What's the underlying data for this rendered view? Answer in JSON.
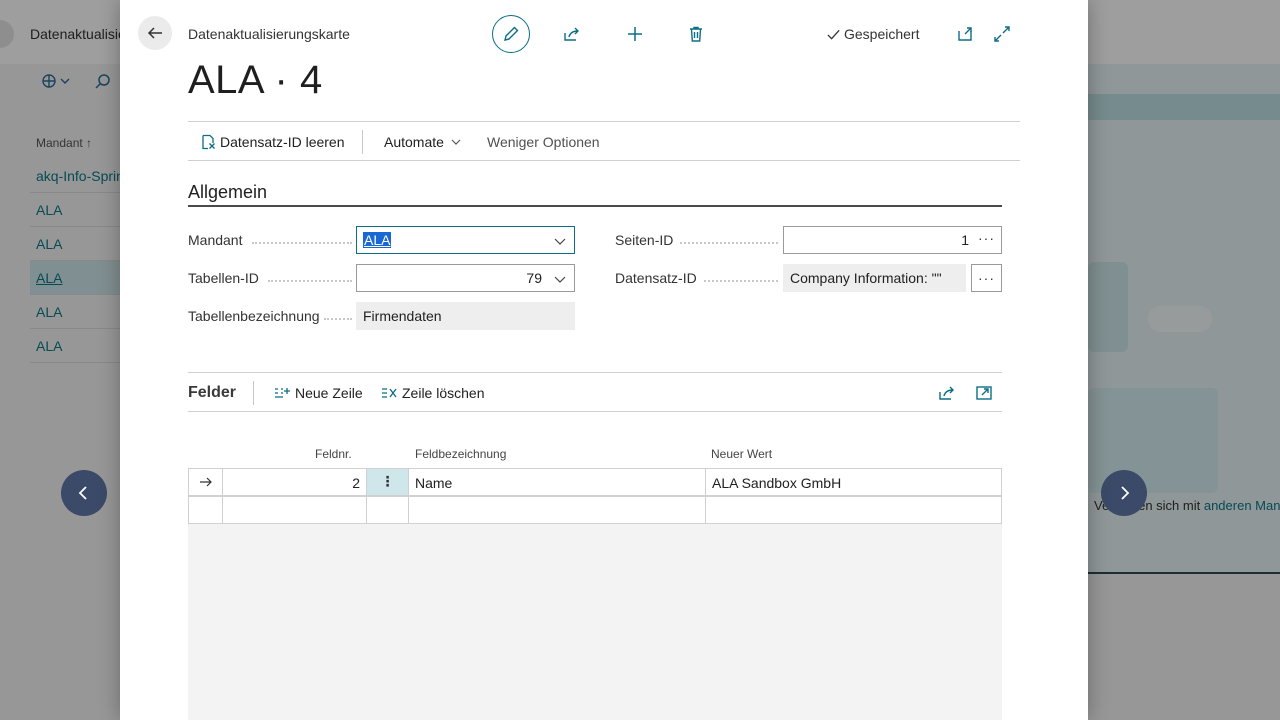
{
  "background": {
    "title": "Datenaktualisierungsliste",
    "column_header": "Mandant ↑",
    "rows": [
      "akq-Info-Sprint",
      "ALA",
      "ALA",
      "ALA",
      "ALA",
      "ALA"
    ],
    "selected_row_index": 3,
    "right_panel_text": "Verbinden sich mit ",
    "right_panel_link": "anderen Mandanten"
  },
  "dialog": {
    "caption": "Datenaktualisierungskarte",
    "saved_label": "Gespeichert",
    "record_title": "ALA · 4",
    "actions": {
      "clear_record_id": "Datensatz-ID leeren",
      "automate": "Automate",
      "fewer_options": "Weniger Optionen"
    },
    "general": {
      "title": "Allgemein",
      "mandant_label": "Mandant",
      "mandant_value": "ALA",
      "table_id_label": "Tabellen-ID",
      "table_id_value": "79",
      "table_name_label": "Tabellenbezeichnung",
      "table_name_value": "Firmendaten",
      "page_id_label": "Seiten-ID",
      "page_id_value": "1",
      "record_id_label": "Datensatz-ID",
      "record_id_value": "Company Information: \"\""
    },
    "fields_part": {
      "title": "Felder",
      "new_line": "Neue Zeile",
      "delete_line": "Zeile löschen",
      "columns": {
        "field_no": "Feldnr.",
        "field_name": "Feldbezeichnung",
        "new_value": "Neuer Wert"
      },
      "rows": [
        {
          "field_no": "2",
          "field_name": "Name",
          "new_value": "ALA Sandbox GmbH"
        }
      ]
    }
  },
  "colors": {
    "accent": "#0b6e86",
    "nav_arrow": "#3a4a68",
    "selection": "#1967d2"
  }
}
